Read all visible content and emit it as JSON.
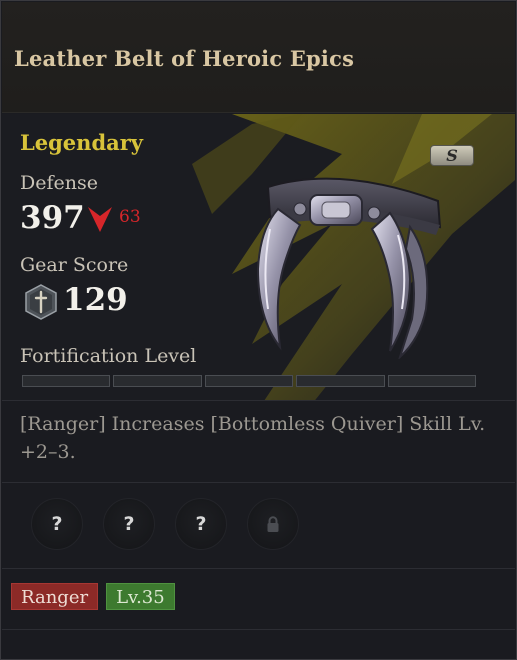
{
  "item": {
    "name": "Leather Belt of Heroic Epics",
    "grade": "Legendary",
    "slot_badge": "S"
  },
  "stats": {
    "defense_label": "Defense",
    "defense_value": "397",
    "defense_diff": "63",
    "defense_diff_direction": "down",
    "gear_score_label": "Gear Score",
    "gear_score_value": "129",
    "fortification_label": "Fortification Level",
    "fortification_filled": 0,
    "fortification_total": 5
  },
  "description": "[Ranger] Increases [Bottomless Quiver] Skill Lv. +2–3.",
  "sockets": [
    {
      "icon": "question-mark-icon",
      "symbol": "?"
    },
    {
      "icon": "question-mark-icon",
      "symbol": "?"
    },
    {
      "icon": "question-mark-icon",
      "symbol": "?"
    },
    {
      "icon": "lock-icon",
      "symbol": ""
    }
  ],
  "tags": {
    "class": "Ranger",
    "level": "Lv.35"
  },
  "colors": {
    "grade": "#d8c33a",
    "decrease": "#d6262a",
    "class_tag": "#8c2a27",
    "level_tag": "#3d7a2f"
  }
}
